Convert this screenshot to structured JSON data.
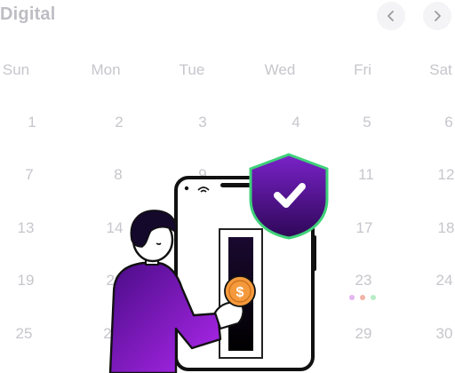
{
  "header": {
    "title": "Digital"
  },
  "nav": {
    "prev_icon": "chevron-left-icon",
    "next_icon": "chevron-right-icon"
  },
  "calendar": {
    "weekdays": [
      "Sun",
      "Mon",
      "Tue",
      "Wed",
      "Fri",
      "Sat"
    ],
    "rows": [
      [
        "1",
        "2",
        "3",
        "4",
        "5",
        "6"
      ],
      [
        "7",
        "8",
        "9",
        "11",
        "12"
      ],
      [
        "13",
        "14",
        "17",
        "18"
      ],
      [
        "19",
        "20",
        "23",
        "24"
      ],
      [
        "25",
        "2",
        "29",
        "30"
      ]
    ],
    "event_dot_colors": [
      "#e4b5f2",
      "#f3b3a6",
      "#b6ecc4"
    ]
  },
  "illustration": {
    "subject": "person-tapping-phone-payment-with-security-shield",
    "shield_icon": "shield-check-icon",
    "coin_symbol": "$",
    "colors": {
      "purple_dark": "#3a0a6b",
      "purple_light": "#a51ee8",
      "shield_border": "#3fd17a",
      "coin": "#f59a3c"
    }
  }
}
